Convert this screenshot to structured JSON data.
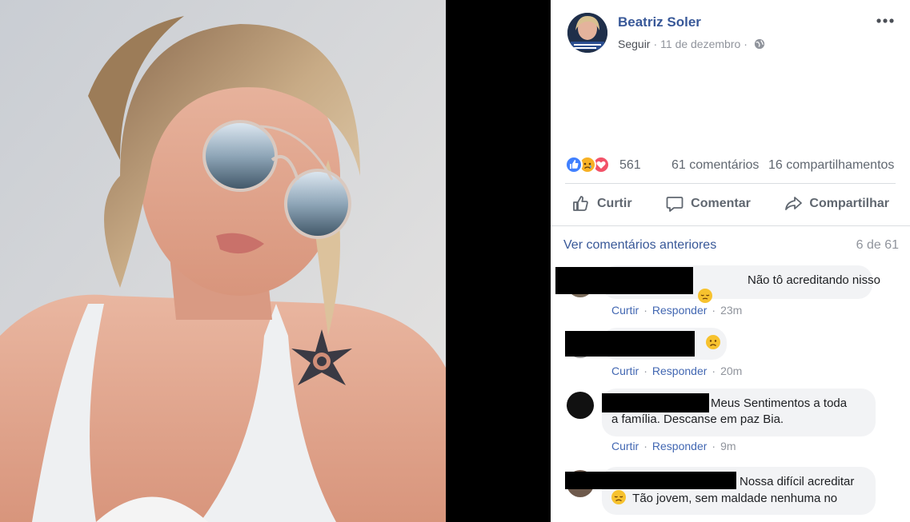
{
  "post": {
    "page_name": "Beatriz Soler",
    "follow_label": "Seguir",
    "date": "11 de dezembro",
    "separator": "·"
  },
  "stats": {
    "reactions_count": "561",
    "comments_label": "61 comentários",
    "shares_label": "16 compartilhamentos"
  },
  "actions": {
    "like": "Curtir",
    "comment": "Comentar",
    "share": "Compartilhar"
  },
  "comments_section": {
    "view_previous": "Ver comentários anteriores",
    "pager": "6 de 61",
    "like_label": "Curtir",
    "reply_label": "Responder",
    "items": [
      {
        "text": "Não tô acreditando nisso",
        "emoji": "pensive-face",
        "time": "23m"
      },
      {
        "text": "",
        "emoji": "frowning-face",
        "time": "20m"
      },
      {
        "text_line1": "Meus Sentimentos a toda",
        "text_line2": "a família. Descanse em paz Bia.",
        "time": "9m"
      },
      {
        "text_line1": "Nossa difícil acreditar",
        "text_line2": "Tão jovem, sem maldade nenhuma no",
        "emoji": "disappointed-face"
      }
    ]
  },
  "colors": {
    "link_blue": "#385898",
    "reaction_like": "#4080ff",
    "reaction_sad": "#f7b125",
    "reaction_love": "#f25268",
    "bubble_bg": "#f2f3f5"
  }
}
